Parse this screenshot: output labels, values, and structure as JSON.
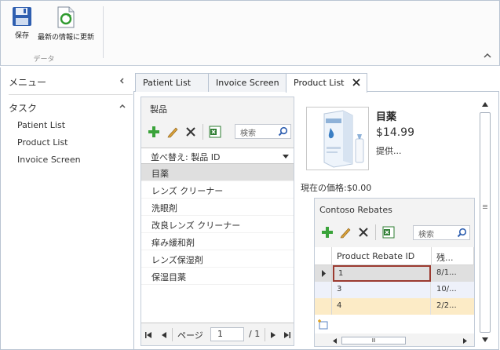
{
  "ribbon": {
    "save_label": "保存",
    "refresh_label": "最新の情報に更新",
    "group_label": "データ"
  },
  "leftpane": {
    "menu_label": "メニュー",
    "tasks_label": "タスク",
    "tasks": [
      "Patient List",
      "Product List",
      "Invoice Screen"
    ]
  },
  "tabs": [
    {
      "label": "Patient List",
      "active": false
    },
    {
      "label": "Invoice Screen",
      "active": false
    },
    {
      "label": "Product List",
      "active": true
    }
  ],
  "products": {
    "title": "製品",
    "search_placeholder": "検索",
    "sort_label": "並べ替え: 製品 ID",
    "items": [
      "目薬",
      "レンズ クリーナー",
      "洗眼剤",
      "改良レンズ クリーナー",
      "痒み緩和剤",
      "レンズ保湿剤",
      "保湿目薬"
    ],
    "selected_index": 0,
    "pager": {
      "label": "ページ",
      "current": "1",
      "total": "/ 1"
    }
  },
  "detail": {
    "name": "目薬",
    "price": "$14.99",
    "description": "提供...",
    "current_price_label": "現在の価格:$0.00"
  },
  "rebates": {
    "title": "Contoso Rebates",
    "search_placeholder": "検索",
    "columns": [
      "Product Rebate ID",
      "残..."
    ],
    "rows": [
      {
        "id": "1",
        "c2": "8/1...",
        "selected": true
      },
      {
        "id": "3",
        "c2": "10/...",
        "selected": false
      },
      {
        "id": "4",
        "c2": "2/2...",
        "selected": false
      }
    ],
    "hscroll_grip": "Ⅲ"
  },
  "colors": {
    "border": "#b9c4d2",
    "selected_row": "#dfdfdf",
    "grid_row_alt": "#eef1fa",
    "grid_row_yellow": "#fcebc6",
    "current_cell_border": "#9b3a30",
    "add_green": "#3aa33a"
  },
  "icons": [
    "floppy-disk-icon",
    "refresh-page-icon",
    "chevron-left-icon",
    "chevron-up-icon",
    "close-icon",
    "add-icon",
    "edit-pencil-icon",
    "delete-x-icon",
    "excel-export-icon",
    "search-icon",
    "first-page-icon",
    "prev-page-icon",
    "next-page-icon",
    "last-page-icon",
    "row-indicator-icon",
    "add-row-icon"
  ]
}
